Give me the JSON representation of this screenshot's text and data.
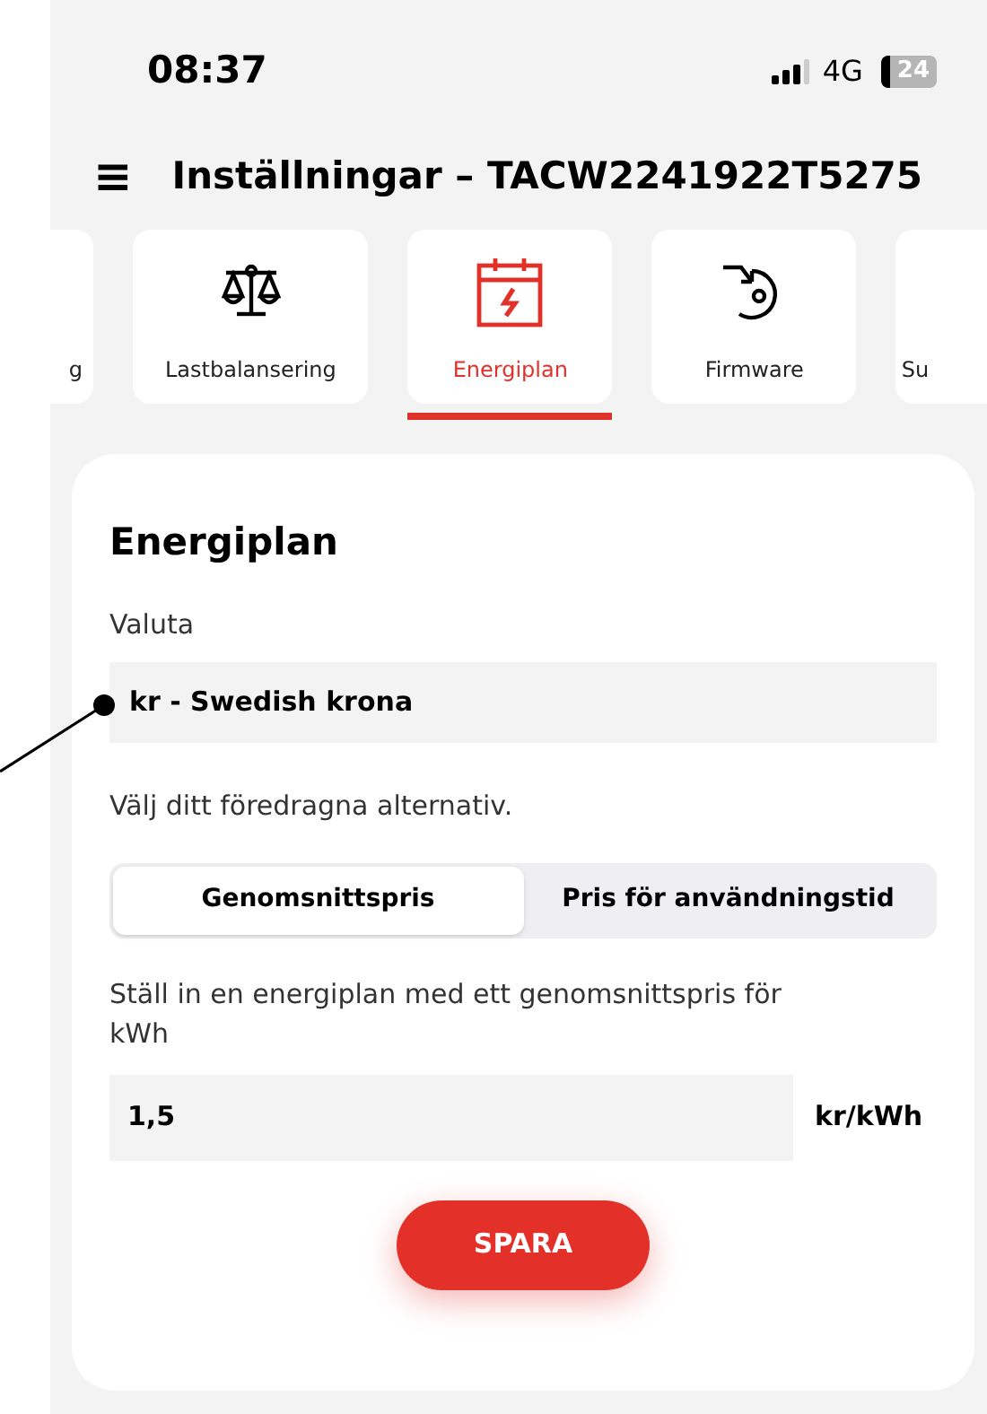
{
  "status_bar": {
    "time": "08:37",
    "network": "4G",
    "battery": "24"
  },
  "header": {
    "menu_icon": "≡",
    "title": "Inställningar – TACW2241922T5275"
  },
  "tabs": [
    {
      "label": "g",
      "kind": "partial-left",
      "selected": false
    },
    {
      "label": "Lastbalansering",
      "kind": "scale",
      "selected": false
    },
    {
      "label": "Energiplan",
      "kind": "calendar",
      "selected": true
    },
    {
      "label": "Firmware",
      "kind": "firmware",
      "selected": false
    },
    {
      "label": "Su",
      "kind": "partial-right",
      "selected": false
    }
  ],
  "card": {
    "title": "Energiplan",
    "currency_label": "Valuta",
    "currency_value": "kr - Swedish krona",
    "choice_label": "Välj ditt föredragna alternativ.",
    "segments": [
      {
        "label": "Genomsnittspris",
        "selected": true
      },
      {
        "label": "Pris för användningstid",
        "selected": false
      }
    ],
    "description": "Ställ in en energiplan med ett genomsnittspris för kWh",
    "price_value": "1,5",
    "price_unit": "kr/kWh",
    "save_button": "SPARA"
  }
}
